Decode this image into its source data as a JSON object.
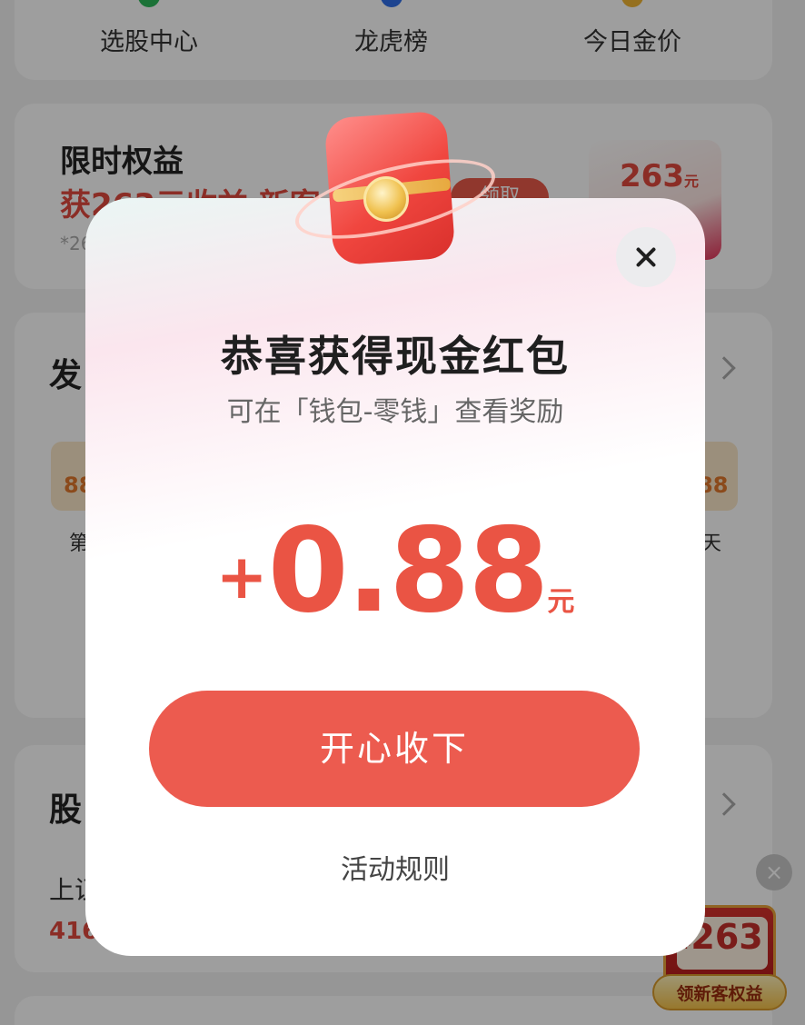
{
  "nav": {
    "items": [
      {
        "label": "选股中心"
      },
      {
        "label": "龙虎榜"
      },
      {
        "label": "今日金价"
      }
    ]
  },
  "promo": {
    "title": "限时权益",
    "subtitle": "获263元收益 新客",
    "button_label": "领取",
    "note": "*26",
    "ticket_amount": "263",
    "ticket_unit": "元"
  },
  "checkin": {
    "title": "发",
    "left_value": "88",
    "right_value": "88",
    "left_label": "第",
    "right_label": "天"
  },
  "stocks": {
    "title": "股",
    "row_label": "上证",
    "row_value": "416"
  },
  "floating_coupon": {
    "currency": "¥",
    "amount": "263",
    "label": "领新客权益",
    "close_glyph": "×"
  },
  "dialog": {
    "title": "恭喜获得现金红包",
    "subtitle": "可在「钱包-零钱」查看奖励",
    "amount_sign": "+",
    "amount": "0.88",
    "amount_unit": "元",
    "accept_label": "开心收下",
    "rules_label": "活动规则"
  },
  "colors": {
    "accent": "#ec5b4f",
    "amount": "#ea5444",
    "overlay": "rgba(0,0,0,0.38)"
  }
}
